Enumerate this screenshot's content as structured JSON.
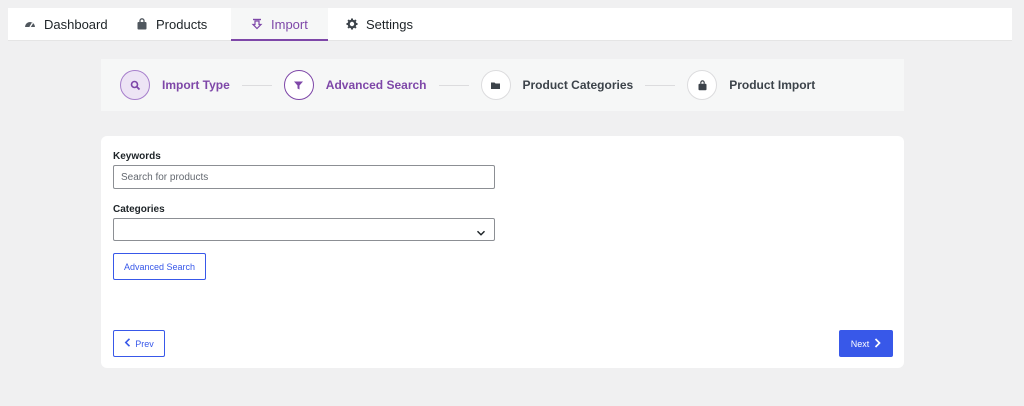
{
  "nav": {
    "tabs": [
      {
        "label": "Dashboard",
        "icon": "gauge-icon"
      },
      {
        "label": "Products",
        "icon": "shopping-bag-icon"
      },
      {
        "label": "Import",
        "icon": "download-icon",
        "active": true
      },
      {
        "label": "Settings",
        "icon": "gear-icon"
      }
    ]
  },
  "stepper": {
    "steps": [
      {
        "label": "Import Type",
        "icon": "search-icon",
        "state": "done"
      },
      {
        "label": "Advanced Search",
        "icon": "filter-icon",
        "state": "current"
      },
      {
        "label": "Product Categories",
        "icon": "folder-icon",
        "state": "todo"
      },
      {
        "label": "Product Import",
        "icon": "shopping-bag-icon",
        "state": "todo"
      }
    ]
  },
  "form": {
    "keywords_label": "Keywords",
    "keywords_placeholder": "Search for products",
    "keywords_value": "",
    "categories_label": "Categories",
    "categories_value": "",
    "advanced_search_label": "Advanced Search"
  },
  "footer": {
    "prev_label": "Prev",
    "next_label": "Next"
  },
  "colors": {
    "accent_purple": "#7e47a8",
    "primary_blue": "#3858e9",
    "background": "#f0f0f1"
  }
}
